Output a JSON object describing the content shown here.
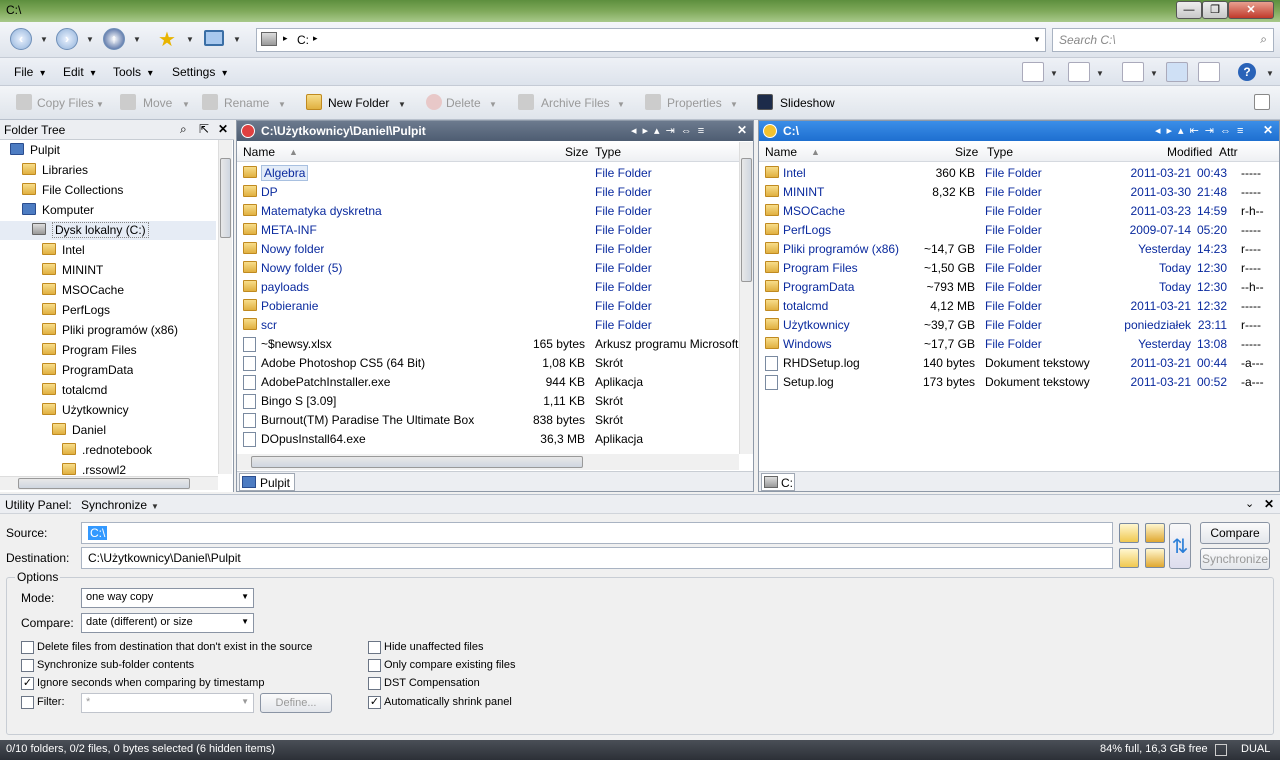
{
  "window": {
    "title": "C:\\",
    "min": "—",
    "max": "❐",
    "close": "✕"
  },
  "nav": {
    "address": "C:",
    "address_sep": "▸",
    "search_placeholder": "Search C:\\"
  },
  "menu": {
    "file": "File",
    "edit": "Edit",
    "tools": "Tools",
    "settings": "Settings"
  },
  "toolbar": {
    "copy": "Copy Files",
    "move": "Move",
    "rename": "Rename",
    "newfolder": "New Folder",
    "delete": "Delete",
    "archive": "Archive Files",
    "properties": "Properties",
    "slideshow": "Slideshow"
  },
  "tree": {
    "title": "Folder Tree",
    "items": [
      {
        "label": "Pulpit",
        "icon": "desktop-icon"
      },
      {
        "label": "Libraries",
        "icon": "libraries-icon"
      },
      {
        "label": "File Collections",
        "icon": "collections-icon"
      },
      {
        "label": "Komputer",
        "icon": "computer-icon"
      },
      {
        "label": "Dysk lokalny (C:)",
        "icon": "drive-icon"
      },
      {
        "label": "Intel",
        "icon": "folder-icon"
      },
      {
        "label": "MININT",
        "icon": "folder-icon"
      },
      {
        "label": "MSOCache",
        "icon": "folder-icon"
      },
      {
        "label": "PerfLogs",
        "icon": "folder-icon"
      },
      {
        "label": "Pliki programów (x86)",
        "icon": "folder-icon"
      },
      {
        "label": "Program Files",
        "icon": "folder-icon"
      },
      {
        "label": "ProgramData",
        "icon": "folder-icon"
      },
      {
        "label": "totalcmd",
        "icon": "folder-icon"
      },
      {
        "label": "Użytkownicy",
        "icon": "users-folder-icon"
      },
      {
        "label": "Daniel",
        "icon": "folder-icon"
      },
      {
        "label": ".rednotebook",
        "icon": "folder-icon"
      },
      {
        "label": ".rssowl2",
        "icon": "folder-icon"
      }
    ]
  },
  "left": {
    "path": "C:\\Użytkownicy\\Daniel\\Pulpit",
    "tab": "Pulpit",
    "cols": {
      "name": "Name",
      "size": "Size",
      "type": "Type"
    },
    "rows": [
      {
        "name": "Algebra",
        "size": "",
        "type": "File Folder",
        "folder": true
      },
      {
        "name": "DP",
        "size": "",
        "type": "File Folder",
        "folder": true
      },
      {
        "name": "Matematyka dyskretna",
        "size": "",
        "type": "File Folder",
        "folder": true
      },
      {
        "name": "META-INF",
        "size": "",
        "type": "File Folder",
        "folder": true
      },
      {
        "name": "Nowy folder",
        "size": "",
        "type": "File Folder",
        "folder": true
      },
      {
        "name": "Nowy folder (5)",
        "size": "",
        "type": "File Folder",
        "folder": true
      },
      {
        "name": "payloads",
        "size": "",
        "type": "File Folder",
        "folder": true
      },
      {
        "name": "Pobieranie",
        "size": "",
        "type": "File Folder",
        "folder": true
      },
      {
        "name": "scr",
        "size": "",
        "type": "File Folder",
        "folder": true
      },
      {
        "name": "~$newsy.xlsx",
        "size": "165 bytes",
        "type": "Arkusz programu Microsoft",
        "folder": false
      },
      {
        "name": "Adobe Photoshop CS5 (64 Bit)",
        "size": "1,08 KB",
        "type": "Skrót",
        "folder": false
      },
      {
        "name": "AdobePatchInstaller.exe",
        "size": "944 KB",
        "type": "Aplikacja",
        "folder": false
      },
      {
        "name": "Bingo S [3.09]",
        "size": "1,11 KB",
        "type": "Skrót",
        "folder": false
      },
      {
        "name": "Burnout(TM) Paradise The Ultimate Box",
        "size": "838 bytes",
        "type": "Skrót",
        "folder": false
      },
      {
        "name": "DOpusInstall64.exe",
        "size": "36,3 MB",
        "type": "Aplikacja",
        "folder": false
      }
    ]
  },
  "right": {
    "path": "C:\\",
    "tab": "C:",
    "cols": {
      "name": "Name",
      "size": "Size",
      "type": "Type",
      "modified": "Modified",
      "attr": "Attr"
    },
    "rows": [
      {
        "name": "Intel",
        "size": "360 KB",
        "type": "File Folder",
        "date": "2011-03-21",
        "time": "00:43",
        "attr": "-----",
        "folder": true
      },
      {
        "name": "MININT",
        "size": "8,32 KB",
        "type": "File Folder",
        "date": "2011-03-30",
        "time": "21:48",
        "attr": "-----",
        "folder": true
      },
      {
        "name": "MSOCache",
        "size": "",
        "type": "File Folder",
        "date": "2011-03-23",
        "time": "14:59",
        "attr": "r-h--",
        "folder": true
      },
      {
        "name": "PerfLogs",
        "size": "",
        "type": "File Folder",
        "date": "2009-07-14",
        "time": "05:20",
        "attr": "-----",
        "folder": true
      },
      {
        "name": "Pliki programów (x86)",
        "size": "~14,7 GB",
        "type": "File Folder",
        "date": "Yesterday",
        "time": "14:23",
        "attr": "r----",
        "folder": true
      },
      {
        "name": "Program Files",
        "size": "~1,50 GB",
        "type": "File Folder",
        "date": "Today",
        "time": "12:30",
        "attr": "r----",
        "folder": true
      },
      {
        "name": "ProgramData",
        "size": "~793 MB",
        "type": "File Folder",
        "date": "Today",
        "time": "12:30",
        "attr": "--h--",
        "folder": true
      },
      {
        "name": "totalcmd",
        "size": "4,12 MB",
        "type": "File Folder",
        "date": "2011-03-21",
        "time": "12:32",
        "attr": "-----",
        "folder": true
      },
      {
        "name": "Użytkownicy",
        "size": "~39,7 GB",
        "type": "File Folder",
        "date": "poniedziałek",
        "time": "23:11",
        "attr": "r----",
        "folder": true
      },
      {
        "name": "Windows",
        "size": "~17,7 GB",
        "type": "File Folder",
        "date": "Yesterday",
        "time": "13:08",
        "attr": "-----",
        "folder": true
      },
      {
        "name": "RHDSetup.log",
        "size": "140 bytes",
        "type": "Dokument tekstowy",
        "date": "2011-03-21",
        "time": "00:44",
        "attr": "-a---",
        "folder": false
      },
      {
        "name": "Setup.log",
        "size": "173 bytes",
        "type": "Dokument tekstowy",
        "date": "2011-03-21",
        "time": "00:52",
        "attr": "-a---",
        "folder": false
      }
    ]
  },
  "util": {
    "title": "Utility Panel:",
    "mode_name": "Synchronize",
    "source_label": "Source:",
    "source_value": "C:\\",
    "dest_label": "Destination:",
    "dest_value": "C:\\Użytkownicy\\Daniel\\Pulpit",
    "compare_btn": "Compare",
    "sync_btn": "Synchronize",
    "options_label": "Options",
    "mode_label": "Mode:",
    "mode_value": "one way copy",
    "compare_label": "Compare:",
    "compare_value": "date (different) or size",
    "cb_delete": "Delete files from destination that don't exist in the source",
    "cb_subfolder": "Synchronize sub-folder contents",
    "cb_seconds": "Ignore seconds when comparing by timestamp",
    "cb_filter": "Filter:",
    "filter_value": "*",
    "define_btn": "Define...",
    "cb_hide": "Hide unaffected files",
    "cb_only": "Only compare existing files",
    "cb_dst": "DST Compensation",
    "cb_shrink": "Automatically shrink panel",
    "checked": {
      "delete": false,
      "subfolder": false,
      "seconds": true,
      "filter": false,
      "hide": false,
      "only": false,
      "dst": false,
      "shrink": true
    }
  },
  "status": {
    "left": "0/10 folders, 0/2 files, 0 bytes selected (6 hidden items)",
    "right": "84% full, 16,3 GB free",
    "dual": "DUAL"
  },
  "colors": {
    "folder_text": "#0a2a9e",
    "date_text": "#0a2a9e",
    "active_header": "#1e6fd0"
  }
}
